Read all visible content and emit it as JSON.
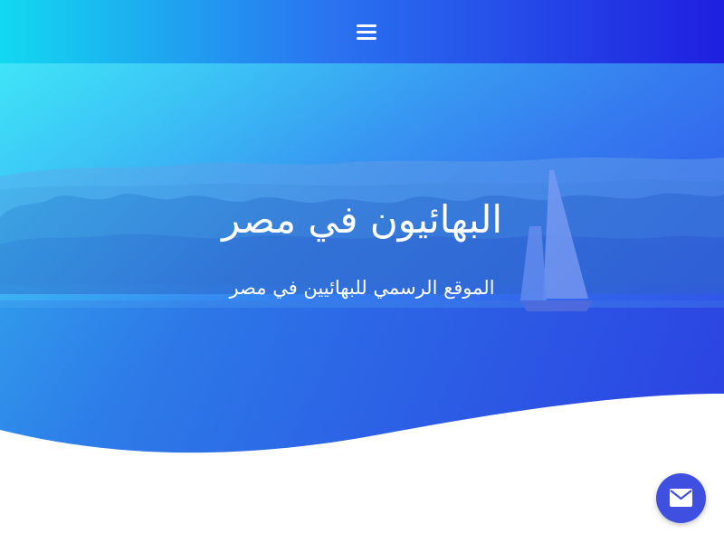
{
  "header": {
    "menu_icon": "hamburger-menu-icon",
    "gradient_colors": [
      "#12d9f0",
      "#2a74f0",
      "#1f1fe0"
    ]
  },
  "hero": {
    "title": "البهائيون في مصر",
    "subtitle": "الموقع الرسمي للبهائيين في مصر"
  },
  "contact_button": {
    "icon": "envelope-icon",
    "color": "#3f4fe0"
  }
}
